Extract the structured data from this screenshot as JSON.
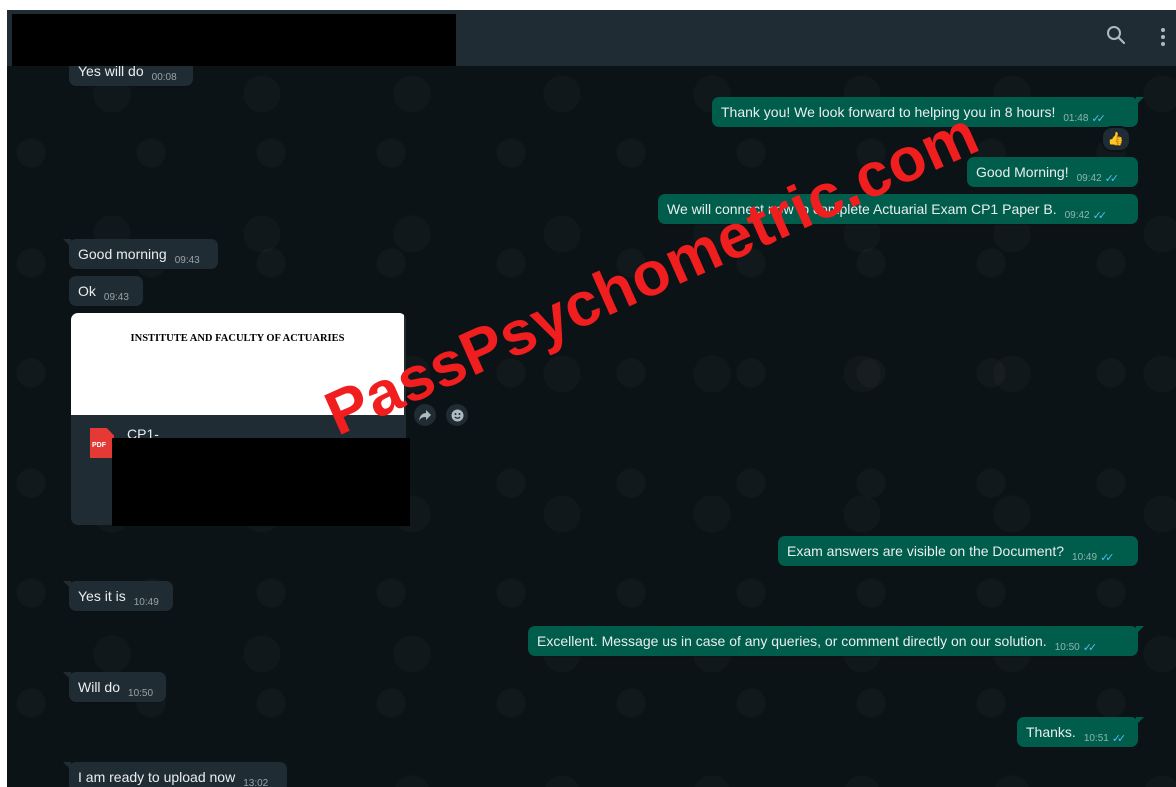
{
  "header": {
    "search_icon": "search-icon",
    "menu_icon": "more-vertical-icon"
  },
  "messages": [
    {
      "text": "Yes will do",
      "time": "00:08",
      "dir": "in"
    },
    {
      "text": "Thank you! We look forward to helping you in 8 hours!",
      "time": "01:48",
      "dir": "out",
      "reaction": "👍"
    },
    {
      "text": "Good Morning!",
      "time": "09:42",
      "dir": "out"
    },
    {
      "text": "We will connect now to complete Actuarial Exam CP1 Paper B.",
      "time": "09:42",
      "dir": "out"
    },
    {
      "text": "Good morning",
      "time": "09:43",
      "dir": "in"
    },
    {
      "text": "Ok",
      "time": "09:43",
      "dir": "in"
    },
    {
      "text": "Exam answers are visible on the Document?",
      "time": "10:49",
      "dir": "out"
    },
    {
      "text": "Yes it is",
      "time": "10:49",
      "dir": "in"
    },
    {
      "text": "Excellent. Message us in case of any queries, or comment directly on our solution.",
      "time": "10:50",
      "dir": "out"
    },
    {
      "text": "Will do",
      "time": "10:50",
      "dir": "in"
    },
    {
      "text": "Thanks.",
      "time": "10:51",
      "dir": "out"
    },
    {
      "text": "I am ready to upload now",
      "time": "13:02",
      "dir": "in"
    }
  ],
  "document": {
    "preview_heading": "INSTITUTE AND FACULTY OF ACTUARIES",
    "file_type": "PDF",
    "file_name": "CP1-"
  },
  "ticks": "✓✓",
  "watermark": "PassPsychometric.com",
  "colors": {
    "background": "#0c1317",
    "incoming": "#202c33",
    "outgoing": "#005c4b",
    "read_ticks": "#53bdeb",
    "watermark": "#f01e1e"
  }
}
